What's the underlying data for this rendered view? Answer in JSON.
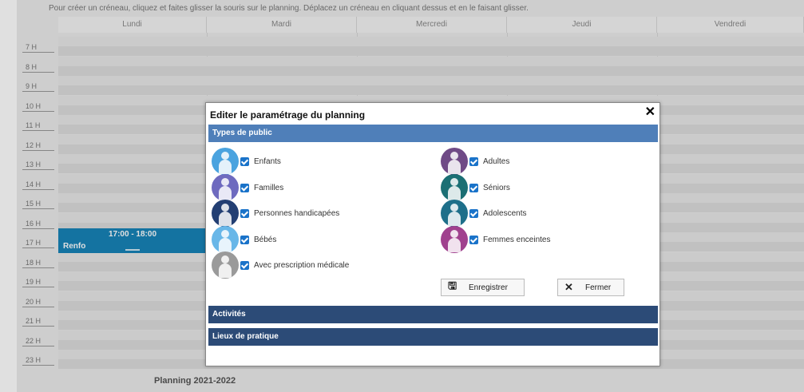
{
  "planning": {
    "instruction": "Pour créer un créneau, cliquez et faites glisser la souris sur le planning. Déplacez un créneau en cliquant dessus et en le faisant glisser.",
    "days": [
      "Lundi",
      "Mardi",
      "Mercredi",
      "Jeudi",
      "Vendredi"
    ],
    "hours": [
      "7 H",
      "8 H",
      "9 H",
      "10 H",
      "11 H",
      "12 H",
      "13 H",
      "14 H",
      "15 H",
      "16 H",
      "17 H",
      "18 H",
      "19 H",
      "20 H",
      "21 H",
      "22 H",
      "23 H"
    ],
    "event": {
      "time": "17:00 - 18:00",
      "name": "Renfo"
    },
    "footer_title": "Planning 2021-2022"
  },
  "modal": {
    "title": "Editer le paramétrage du planning",
    "close_icon": "close-icon",
    "sections": {
      "public": "Types de public",
      "activities": "Activités",
      "places": "Lieux de pratique"
    },
    "left_items": [
      {
        "label": "Enfants",
        "checked": true,
        "color": "#4aa3df",
        "icon": "children-icon"
      },
      {
        "label": "Familles",
        "checked": true,
        "color": "#6e6abf",
        "icon": "family-icon"
      },
      {
        "label": "Personnes handicapées",
        "checked": true,
        "color": "#233f73",
        "icon": "wheelchair-icon"
      },
      {
        "label": "Bébés",
        "checked": true,
        "color": "#69b7e8",
        "icon": "baby-icon"
      },
      {
        "label": "Avec prescription médicale",
        "checked": true,
        "color": "#9a9a9a",
        "icon": "doctor-icon"
      }
    ],
    "right_items": [
      {
        "label": "Adultes",
        "checked": true,
        "color": "#6f4a86",
        "icon": "adult-icon"
      },
      {
        "label": "Séniors",
        "checked": true,
        "color": "#1b6f74",
        "icon": "senior-icon"
      },
      {
        "label": "Adolescents",
        "checked": true,
        "color": "#1e6f8a",
        "icon": "teenager-icon"
      },
      {
        "label": "Femmes enceintes",
        "checked": true,
        "color": "#a0418e",
        "icon": "pregnant-icon"
      }
    ],
    "buttons": {
      "save": "Enregistrer",
      "close": "Fermer"
    }
  }
}
